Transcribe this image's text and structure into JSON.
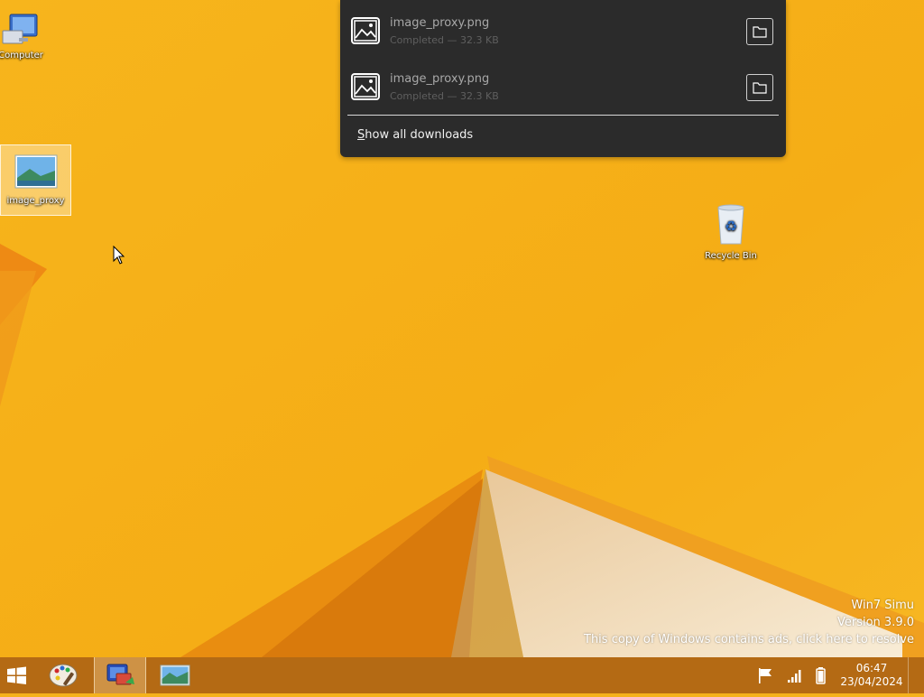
{
  "desktop": {
    "icons": [
      {
        "label": "Computer",
        "icon": "computer-icon"
      },
      {
        "label": "image_proxy",
        "icon": "image-file-icon",
        "selected": true
      },
      {
        "label": "Recycle Bin",
        "icon": "recycle-bin-icon"
      }
    ]
  },
  "downloads": {
    "items": [
      {
        "name": "image_proxy.png",
        "status": "Completed — 32.3 KB",
        "icon": "image-file-icon",
        "action_icon": "folder-icon"
      },
      {
        "name": "image_proxy.png",
        "status": "Completed — 32.3 KB",
        "icon": "image-file-icon",
        "action_icon": "folder-icon"
      }
    ],
    "show_all_first": "S",
    "show_all_rest": "how all downloads"
  },
  "watermark": {
    "line1": "Win7 Simu",
    "line2": "Version 3.9.0",
    "line3": "This copy of Windows contains ads, click here to resolve"
  },
  "taskbar": {
    "start_icon": "windows-logo-icon",
    "pinned": [
      {
        "name": "paint-icon"
      },
      {
        "name": "explorer-icon",
        "active": true
      },
      {
        "name": "photos-icon"
      }
    ],
    "tray": [
      "flag-icon",
      "signal-icon",
      "battery-icon"
    ],
    "time": "06:47",
    "date": "23/04/2024"
  },
  "colors": {
    "wallpaper": "#f5b21c",
    "taskbar": "#b46a14",
    "popup": "#2b2b2b"
  }
}
